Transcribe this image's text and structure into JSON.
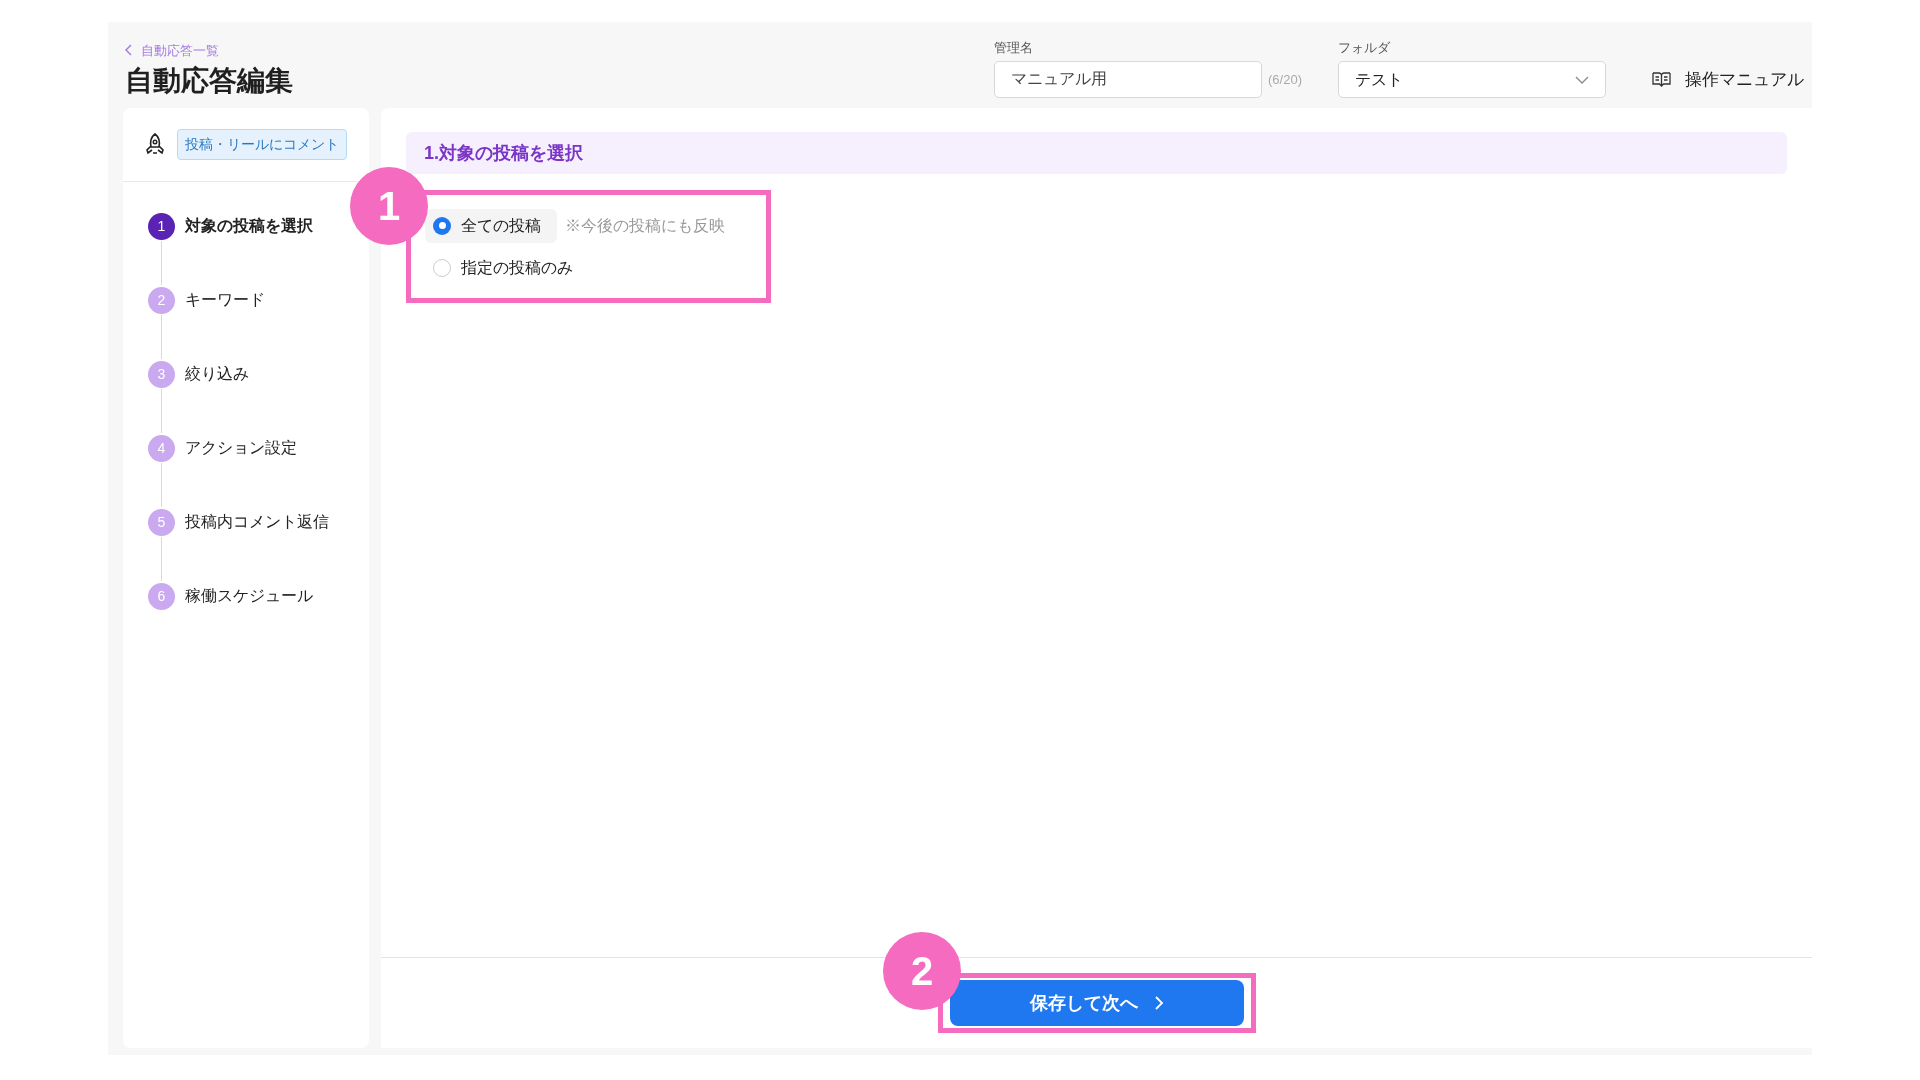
{
  "header": {
    "back_link": "自動応答一覧",
    "title": "自動応答編集",
    "name_field": {
      "label": "管理名",
      "value": "マニュアル用",
      "counter": "(6/20)"
    },
    "folder_field": {
      "label": "フォルダ",
      "value": "テスト"
    },
    "manual_link": "操作マニュアル"
  },
  "sidebar": {
    "tag": "投稿・リールにコメント",
    "steps": [
      {
        "number": "1",
        "label": "対象の投稿を選択",
        "selected": true
      },
      {
        "number": "2",
        "label": "キーワード",
        "selected": false
      },
      {
        "number": "3",
        "label": "絞り込み",
        "selected": false
      },
      {
        "number": "4",
        "label": "アクション設定",
        "selected": false
      },
      {
        "number": "5",
        "label": "投稿内コメント返信",
        "selected": false
      },
      {
        "number": "6",
        "label": "稼働スケジュール",
        "selected": false
      }
    ]
  },
  "section_title": "1.対象の投稿を選択",
  "options": [
    {
      "label": "全ての投稿",
      "note": "※今後の投稿にも反映",
      "selected": true
    },
    {
      "label": "指定の投稿のみ",
      "selected": false
    }
  ],
  "next_button": "保存して次へ",
  "annotations": [
    {
      "number": "1"
    },
    {
      "number": "2"
    }
  ]
}
